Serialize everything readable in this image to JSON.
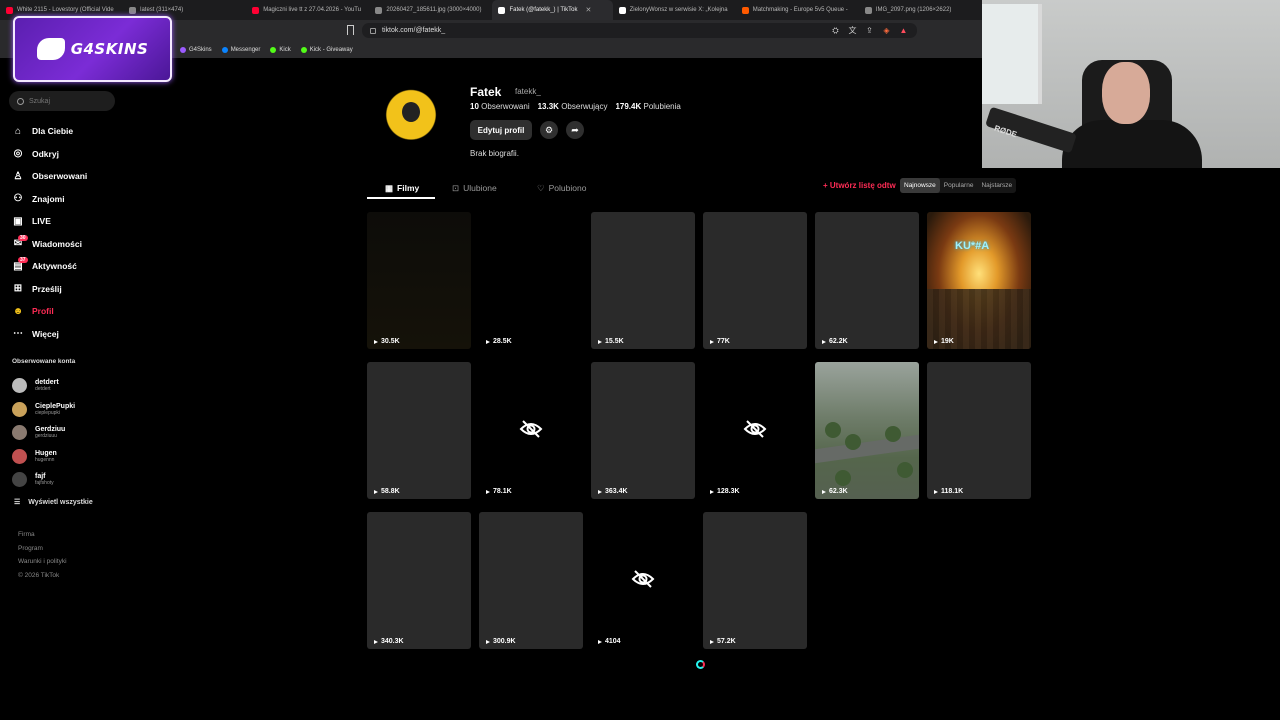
{
  "browser": {
    "tabs": [
      {
        "label": "White 2115 - Lovestory (Official Vide",
        "color": "#ff0033"
      },
      {
        "label": "latest (311×474)",
        "color": "#888888"
      },
      {
        "label": "Magiczni live tt z 27.04.2026 - YouTu",
        "color": "#ff0033"
      },
      {
        "label": "20260427_185611.jpg (3000×4000)",
        "color": "#888888"
      },
      {
        "label": "Fatek (@fatekk_) | TikTok",
        "color": "#ffffff",
        "active": true
      },
      {
        "label": "ZielonyWonsz w serwisie X: „Kolejna",
        "color": "#ffffff"
      },
      {
        "label": "Matchmaking - Europe 5v5 Queue -",
        "color": "#ff5a00"
      },
      {
        "label": "IMG_2097.png (1206×2622)",
        "color": "#888888"
      }
    ],
    "url": "tiktok.com/@fatekk_",
    "bookmarks": [
      {
        "label": "G4Skins",
        "color": "#9b5bff"
      },
      {
        "label": "Messenger",
        "color": "#0a84ff"
      },
      {
        "label": "Kick",
        "color": "#53fc18"
      },
      {
        "label": "Kick - Giveaway",
        "color": "#53fc18"
      }
    ]
  },
  "overlay": {
    "brand": "G4SKINS"
  },
  "sidebar": {
    "search_placeholder": "Szukaj",
    "nav": [
      {
        "label": "Dla Ciebie",
        "icon": "home-icon"
      },
      {
        "label": "Odkryj",
        "icon": "compass-icon"
      },
      {
        "label": "Obserwowani",
        "icon": "following-icon"
      },
      {
        "label": "Znajomi",
        "icon": "friends-icon"
      },
      {
        "label": "LIVE",
        "icon": "live-icon"
      },
      {
        "label": "Wiadomości",
        "icon": "messages-icon",
        "badge": "30"
      },
      {
        "label": "Aktywność",
        "icon": "activity-icon",
        "badge": "37"
      },
      {
        "label": "Prześlij",
        "icon": "upload-icon"
      },
      {
        "label": "Profil",
        "icon": "profile-icon",
        "active": true
      },
      {
        "label": "Więcej",
        "icon": "more-icon"
      }
    ],
    "followed_title": "Obserwowane konta",
    "followed": [
      {
        "name": "detdert",
        "handle": "detdert"
      },
      {
        "name": "CieplePupki",
        "handle": "cieplepupki"
      },
      {
        "name": "Gerdziuu",
        "handle": "gerdziuuu"
      },
      {
        "name": "Hugen",
        "handle": "hugennn"
      },
      {
        "name": "fajf",
        "handle": "fajfshoty"
      }
    ],
    "see_all": "Wyświetl wszystkie",
    "footer": [
      "Firma",
      "Program",
      "Warunki i polityki",
      "© 2026 TikTok"
    ]
  },
  "profile": {
    "name": "Fatek",
    "handle": "fatekk_",
    "following_count": "10",
    "following_label": "Obserwowani",
    "followers_count": "13.3K",
    "followers_label": "Obserwujący",
    "likes_count": "179.4K",
    "likes_label": "Polubienia",
    "edit_button": "Edytuj profil",
    "bio": "Brak biografii."
  },
  "tabs": [
    {
      "label": "Filmy",
      "active": true
    },
    {
      "label": "Ulubione"
    },
    {
      "label": "Polubiono"
    }
  ],
  "playlist_link": "+ Utwórz listę odtw",
  "sort": [
    "Najnowsze",
    "Popularne",
    "Najstarsze"
  ],
  "videos": [
    {
      "views": "30.5K",
      "style": "dark"
    },
    {
      "views": "28.5K",
      "style": "blank"
    },
    {
      "views": "15.5K",
      "style": "grey"
    },
    {
      "views": "77K",
      "style": "grey"
    },
    {
      "views": "62.2K",
      "style": "grey"
    },
    {
      "views": "19K",
      "style": "fire",
      "overlay_text": "KU*#A"
    },
    {
      "views": "58.8K",
      "style": "grey"
    },
    {
      "views": "78.1K",
      "style": "hidden"
    },
    {
      "views": "363.4K",
      "style": "grey"
    },
    {
      "views": "128.3K",
      "style": "hidden"
    },
    {
      "views": "62.3K",
      "style": "city"
    },
    {
      "views": "118.1K",
      "style": "grey"
    },
    {
      "views": "340.3K",
      "style": "grey"
    },
    {
      "views": "300.9K",
      "style": "grey"
    },
    {
      "views": "4104",
      "style": "hidden"
    },
    {
      "views": "57.2K",
      "style": "grey"
    }
  ],
  "webcam": {
    "mic_brand": "RØDE"
  }
}
